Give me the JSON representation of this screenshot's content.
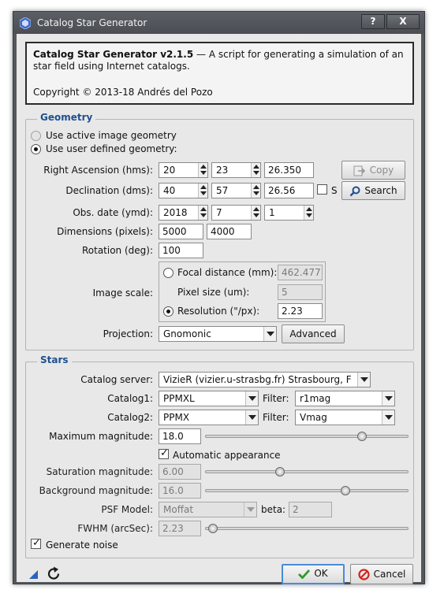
{
  "window": {
    "title": "Catalog Star Generator",
    "help_label": "?",
    "close_label": "X"
  },
  "info": {
    "name": "Catalog Star Generator v2.1.5",
    "description": " — A script for generating a simulation of an star field using Internet catalogs.",
    "copyright": "Copyright © 2013-18 Andrés del Pozo"
  },
  "geometry": {
    "title": "Geometry",
    "use_active_label": "Use active image geometry",
    "use_user_label": "Use user defined geometry:",
    "ra": {
      "label": "Right Ascension (hms):",
      "h": "20",
      "m": "23",
      "s": "26.350"
    },
    "dec": {
      "label": "Declination (dms):",
      "d": "40",
      "m": "57",
      "s": "26.56",
      "south_label": "S"
    },
    "date": {
      "label": "Obs. date (ymd):",
      "y": "2018",
      "m": "7",
      "d": "1"
    },
    "dimensions": {
      "label": "Dimensions (pixels):",
      "w": "5000",
      "h": "4000"
    },
    "rotation": {
      "label": "Rotation (deg):",
      "value": "100"
    },
    "image_scale_label": "Image scale:",
    "focal": {
      "label": "Focal distance (mm):",
      "value": "462.477"
    },
    "pixel": {
      "label": "Pixel size (um):",
      "value": "5"
    },
    "resolution": {
      "label": "Resolution (\"/px):",
      "value": "2.23"
    },
    "projection": {
      "label": "Projection:",
      "value": "Gnomonic",
      "advanced_label": "Advanced"
    },
    "copy_label": "Copy",
    "search_label": "Search"
  },
  "stars": {
    "title": "Stars",
    "server": {
      "label": "Catalog server:",
      "value": "VizieR (vizier.u-strasbg.fr) Strasbourg, F"
    },
    "catalog1": {
      "label": "Catalog1:",
      "value": "PPMXL",
      "filter_label": "Filter:",
      "filter": "r1mag"
    },
    "catalog2": {
      "label": "Catalog2:",
      "value": "PPMX",
      "filter_label": "Filter:",
      "filter": "Vmag"
    },
    "max_mag": {
      "label": "Maximum magnitude:",
      "value": "18.0",
      "slider_fraction": 0.77
    },
    "auto_label": "Automatic appearance",
    "saturation": {
      "label": "Saturation magnitude:",
      "value": "6.00",
      "slider_fraction": 0.37
    },
    "background": {
      "label": "Background magnitude:",
      "value": "16.0",
      "slider_fraction": 0.69
    },
    "psf": {
      "label": "PSF Model:",
      "value": "Moffat",
      "beta_label": "beta:",
      "beta": "2"
    },
    "fwhm": {
      "label": "FWHM (arcSec):",
      "value": "2.23",
      "slider_fraction": 0.04
    },
    "noise_label": "Generate noise"
  },
  "footer": {
    "ok_label": "OK",
    "cancel_label": "Cancel"
  },
  "colors": {
    "group_title": "#1f4f8f",
    "ok_check": "#2e9b2e",
    "cancel_icon": "#d0261e",
    "search_icon": "#1f4f8f"
  }
}
